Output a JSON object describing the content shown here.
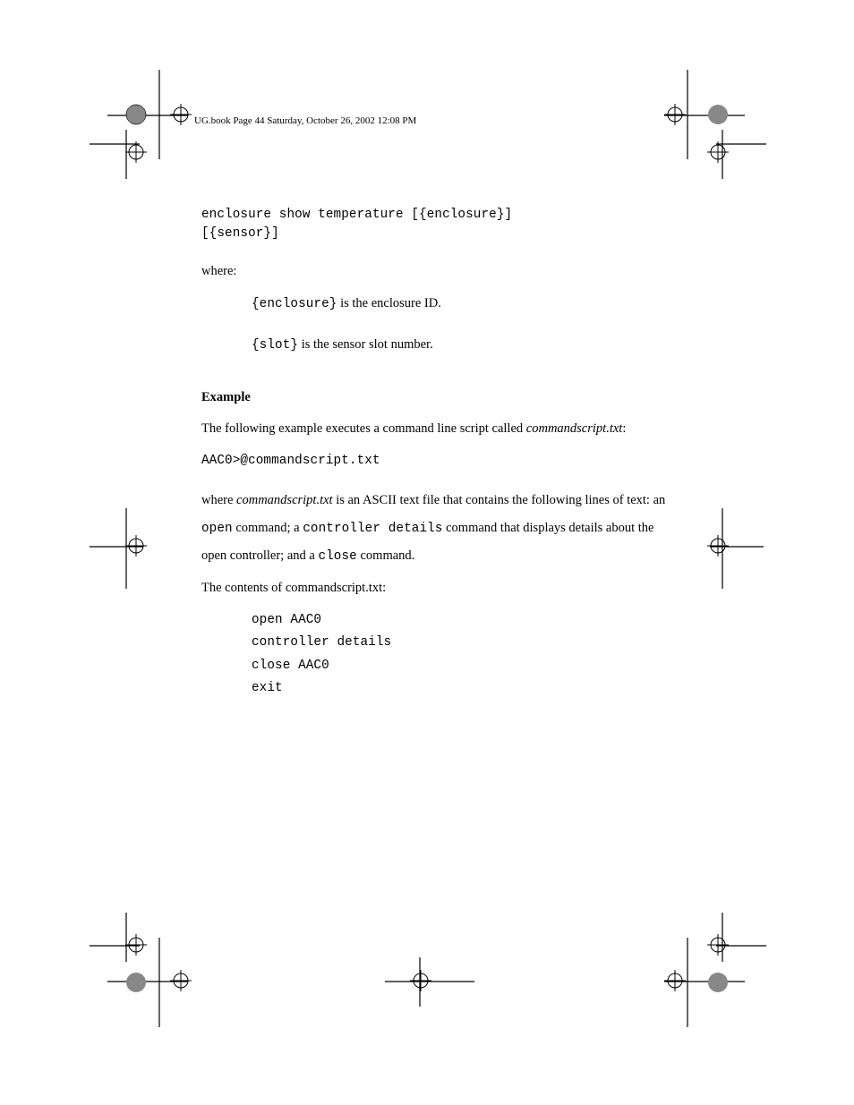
{
  "header": "UG.book  Page 44  Saturday, October 26, 2002  12:08 PM",
  "cmd": {
    "line1": "enclosure show temperature [{enclosure}]",
    "line2": "[{sensor}]"
  },
  "where_text": "where:",
  "param_enclosure": {
    "name": "{enclosure}",
    "desc": " is the enclosure ID."
  },
  "param_slot": {
    "name": "{slot}",
    "desc": " is the sensor slot number."
  },
  "example_heading": "Example",
  "example_text_leadin": "The following example executes a command line script called ",
  "example_filename": "commandscript.txt",
  "example_text_trail": ":",
  "example_cmd": "AAC0>@commandscript.txt",
  "para_prefix_a": "where ",
  "para_prefix_b": "commandscript.txt",
  "para_mid1": " is an ASCII text file that contains the following lines of text: an ",
  "para_open": "open",
  "para_mid2": " command; a ",
  "para_ctrl": "controller details",
  "para_mid3": " command that displays details about the open controller; and a ",
  "para_close": "close",
  "para_end": " command.",
  "para2": "The contents of commandscript.txt:",
  "script": {
    "l1": "open AAC0",
    "l2": "controller details",
    "l3": "close AAC0",
    "l4": "exit"
  }
}
